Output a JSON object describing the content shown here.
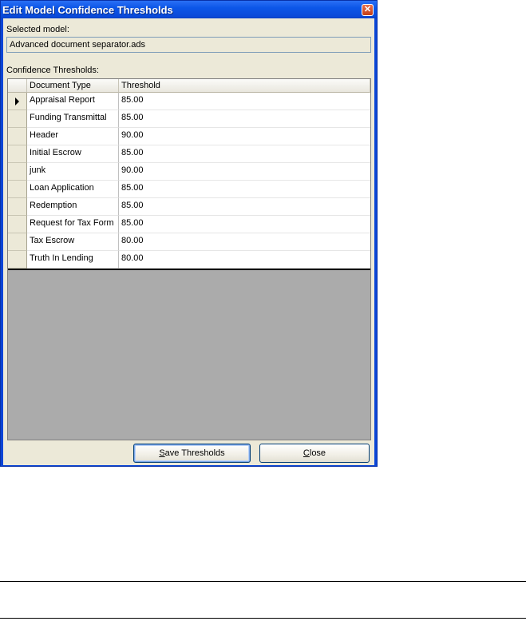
{
  "window": {
    "title": "Edit Model Confidence Thresholds",
    "close_glyph": "✕"
  },
  "selected_model": {
    "label": "Selected model:",
    "value": "Advanced document separator.ads"
  },
  "thresholds": {
    "label": "Confidence Thresholds:",
    "columns": [
      "Document Type",
      "Threshold"
    ],
    "rows": [
      {
        "type": "Appraisal Report",
        "threshold": "85.00",
        "current": true
      },
      {
        "type": "Funding Transmittal",
        "threshold": "85.00"
      },
      {
        "type": "Header",
        "threshold": "90.00"
      },
      {
        "type": "Initial Escrow",
        "threshold": "85.00"
      },
      {
        "type": "junk",
        "threshold": "90.00"
      },
      {
        "type": "Loan Application",
        "threshold": "85.00"
      },
      {
        "type": "Redemption",
        "threshold": "85.00"
      },
      {
        "type": "Request for Tax Form",
        "threshold": "85.00"
      },
      {
        "type": "Tax Escrow",
        "threshold": "80.00"
      },
      {
        "type": "Truth In Lending",
        "threshold": "80.00"
      }
    ]
  },
  "buttons": {
    "save": {
      "mnemonic": "S",
      "rest": "ave Thresholds"
    },
    "close": {
      "mnemonic": "C",
      "rest": "lose"
    }
  }
}
